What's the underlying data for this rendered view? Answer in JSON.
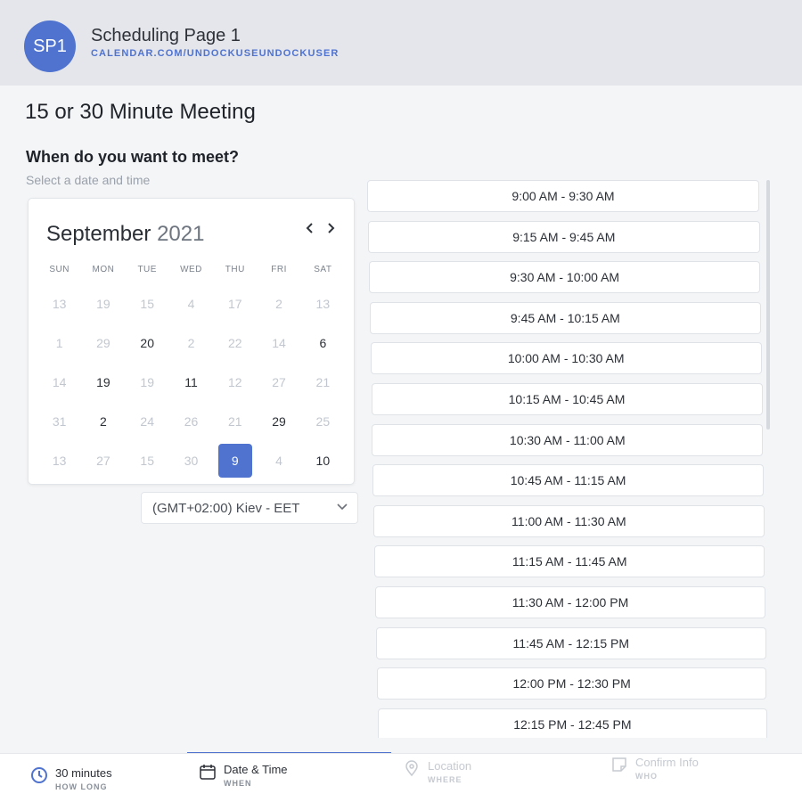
{
  "header": {
    "avatar_initials": "SP1",
    "title": "Scheduling Page 1",
    "url": "CALENDAR.COM/UNDOCKUSEUNDOCKUSER"
  },
  "meeting": {
    "title": "15 or 30 Minute Meeting",
    "question": "When do you want to meet?",
    "subtitle": "Select a date and time"
  },
  "calendar": {
    "month": "September",
    "year": "2021",
    "weekdays": [
      "SUN",
      "MON",
      "TUE",
      "WED",
      "THU",
      "FRI",
      "SAT"
    ],
    "weeks": [
      [
        {
          "d": "13",
          "a": false
        },
        {
          "d": "19",
          "a": false
        },
        {
          "d": "15",
          "a": false
        },
        {
          "d": "4",
          "a": false
        },
        {
          "d": "17",
          "a": false
        },
        {
          "d": "2",
          "a": false
        },
        {
          "d": "13",
          "a": false
        }
      ],
      [
        {
          "d": "1",
          "a": false
        },
        {
          "d": "29",
          "a": false
        },
        {
          "d": "20",
          "a": true
        },
        {
          "d": "2",
          "a": false
        },
        {
          "d": "22",
          "a": false
        },
        {
          "d": "14",
          "a": false
        },
        {
          "d": "6",
          "a": true
        }
      ],
      [
        {
          "d": "14",
          "a": false
        },
        {
          "d": "19",
          "a": true
        },
        {
          "d": "19",
          "a": false
        },
        {
          "d": "11",
          "a": true
        },
        {
          "d": "12",
          "a": false
        },
        {
          "d": "27",
          "a": false
        },
        {
          "d": "21",
          "a": false
        }
      ],
      [
        {
          "d": "31",
          "a": false
        },
        {
          "d": "2",
          "a": true
        },
        {
          "d": "24",
          "a": false
        },
        {
          "d": "26",
          "a": false
        },
        {
          "d": "21",
          "a": false
        },
        {
          "d": "29",
          "a": true
        },
        {
          "d": "25",
          "a": false
        }
      ],
      [
        {
          "d": "13",
          "a": false
        },
        {
          "d": "27",
          "a": false
        },
        {
          "d": "15",
          "a": false
        },
        {
          "d": "30",
          "a": false
        },
        {
          "d": "9",
          "a": true,
          "sel": true
        },
        {
          "d": "4",
          "a": false
        },
        {
          "d": "10",
          "a": true
        }
      ]
    ]
  },
  "timezone": {
    "label": "(GMT+02:00) Kiev - EET"
  },
  "slots": [
    "9:00 AM - 9:30 AM",
    "9:15 AM - 9:45 AM",
    "9:30 AM - 10:00 AM",
    "9:45 AM - 10:15 AM",
    "10:00 AM - 10:30 AM",
    "10:15 AM - 10:45 AM",
    "10:30 AM - 11:00 AM",
    "10:45 AM - 11:15 AM",
    "11:00 AM - 11:30 AM",
    "11:15 AM - 11:45 AM",
    "11:30 AM - 12:00 PM",
    "11:45 AM - 12:15 PM",
    "12:00 PM - 12:30 PM",
    "12:15 PM - 12:45 PM"
  ],
  "footer": {
    "steps": [
      {
        "label": "30 minutes",
        "sub": "HOW LONG",
        "icon": "clock-icon"
      },
      {
        "label": "Date & Time",
        "sub": "WHEN",
        "icon": "calendar-icon"
      },
      {
        "label": "Location",
        "sub": "WHERE",
        "icon": "location-pin-icon"
      },
      {
        "label": "Confirm Info",
        "sub": "WHO",
        "icon": "note-icon"
      }
    ]
  },
  "colors": {
    "accent": "#4f73cf",
    "muted_day": "#c2c7cf",
    "header_bg": "#e4e6ec"
  }
}
